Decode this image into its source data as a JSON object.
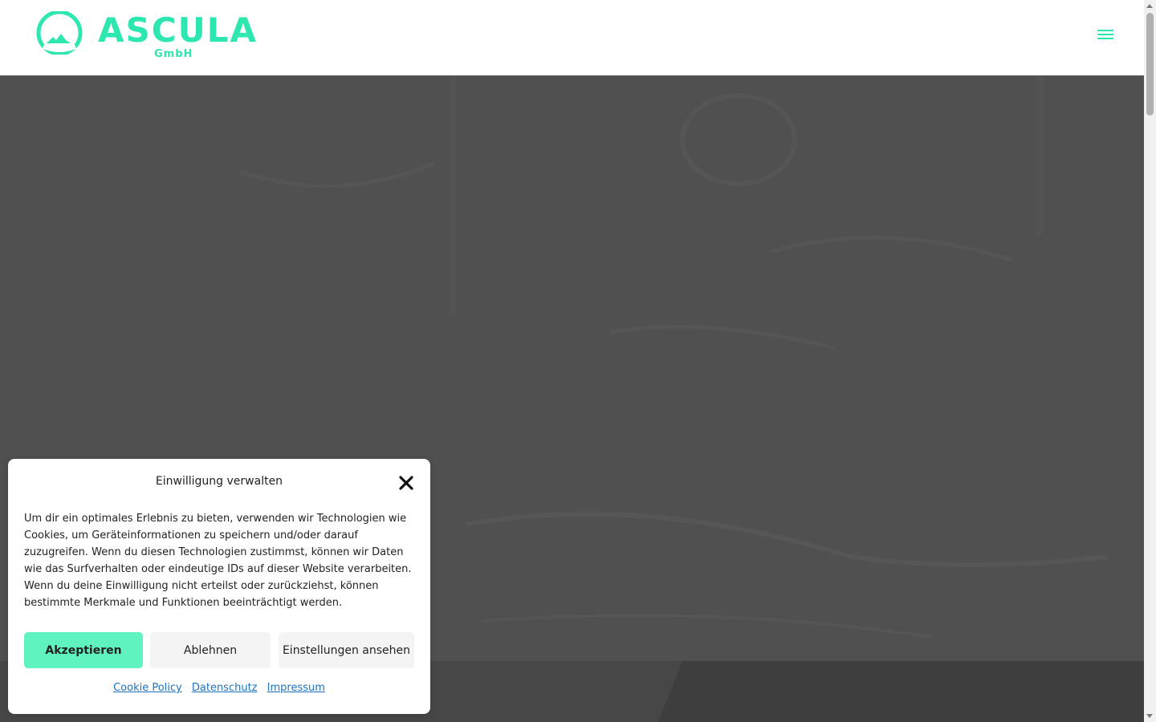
{
  "header": {
    "brand_name": "ASCULA",
    "brand_suffix": "GmbH",
    "accent_color": "#2ee6b0"
  },
  "cookie_dialog": {
    "title": "Einwilligung verwalten",
    "body": "Um dir ein optimales Erlebnis zu bieten, verwenden wir Technologien wie Cookies, um Geräteinformationen zu speichern und/oder darauf zuzugreifen. Wenn du diesen Technologien zustimmst, können wir Daten wie das Surfverhalten oder eindeutige IDs auf dieser Website verarbeiten. Wenn du deine Einwilligung nicht erteilst oder zurückziehst, können bestimmte Merkmale und Funktionen beeinträchtigt werden.",
    "accept_label": "Akzeptieren",
    "deny_label": "Ablehnen",
    "settings_label": "Einstellungen ansehen",
    "links": {
      "cookie_policy": "Cookie Policy",
      "privacy": "Datenschutz",
      "imprint": "Impressum"
    },
    "accept_color": "#5ff4bf"
  }
}
